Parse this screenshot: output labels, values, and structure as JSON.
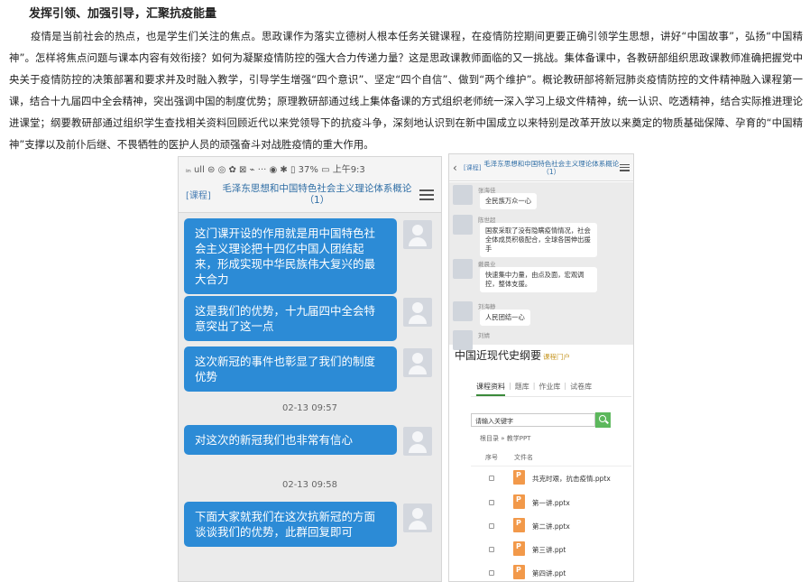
{
  "article": {
    "heading": "发挥引领、加强引导，汇聚抗疫能量",
    "paragraph": "疫情是当前社会的热点，也是学生们关注的焦点。思政课作为落实立德树人根本任务关键课程，在疫情防控期间更要正确引领学生思想，讲好“中国故事”，弘扬“中国精神”。怎样将焦点问题与课本内容有效衔接？如何为凝聚疫情防控的强大合力传递力量？这是思政课教师面临的又一挑战。集体备课中，各教研部组织思政课教师准确把握党中央关于疫情防控的决策部署和要求并及时融入教学，引导学生增强“四个意识”、坚定“四个自信”、做到“两个维护”。概论教研部将新冠肺炎疫情防控的文件精神融入课程第一课，结合十九届四中全会精神，突出强调中国的制度优势；原理教研部通过线上集体备课的方式组织老师统一深入学习上级文件精神，统一认识、吃透精神，结合实际推进理论进课堂；纲要教研部通过组织学生查找相关资料回顾近代以来党领导下的抗疫斗争，深刻地认识到在新中国成立以来特别是改革开放以来奠定的物质基础保障、孕育的“中国精神”支撑以及前仆后继、不畏牺牲的医护人员的顽强奋斗对战胜疫情的重大作用。"
  },
  "phone_left": {
    "status_bar": "ᵢₙ ull ⊜ ◎ ✿ ⊠ ⌁ ··· ◉ ✱ ▯ 37% ▭ 上午9:3",
    "header_tag": "[课程]",
    "header_title": "毛泽东思想和中国特色社会主义理论体系概论（1）",
    "messages": [
      "这门课开设的作用就是用中国特色社会主义理论把十四亿中国人团结起来，形成实现中华民族伟大复兴的最大合力",
      "这是我们的优势，十九届四中全会特意突出了这一点",
      "这次新冠的事件也彰显了我们的制度优势",
      "对这次的新冠我们也非常有信心",
      "下面大家就我们在这次抗新冠的方面谈谈我们的优势，此群回复即可"
    ],
    "timestamps": [
      "02-13 09:57",
      "02-13 09:58"
    ]
  },
  "phone_right": {
    "header_tag": "[课程]",
    "header_title": "毛泽东思想和中国特色社会主义理论体系概论（1）",
    "chat": [
      {
        "name": "张海佳",
        "text": "全民族万众一心"
      },
      {
        "name": "陈世超",
        "text": "国家采取了没有隐瞒疫情情况，社会全体成员积极配合，全球各国伸出援手"
      },
      {
        "name": "戴晨业",
        "text": "快速集中力量，由点及面，宏观调控，整体支援。"
      },
      {
        "name": "刘海静",
        "text": "人民团结一心"
      },
      {
        "name": "刘婧",
        "text": ""
      }
    ],
    "course_title": "中国近现代史纲要",
    "course_portal": "课程门户",
    "tabs": [
      "课程资料",
      "题库",
      "作业库",
      "试卷库"
    ],
    "search_placeholder": "请输入关键字",
    "breadcrumb": "根目录 »  教学PPT",
    "col_no": "序号",
    "col_name": "文件名",
    "files": [
      "共克时艰，抗击疫情.pptx",
      "第一讲.pptx",
      "第二讲.pptx",
      "第三讲.ppt",
      "第四讲.ppt"
    ]
  }
}
